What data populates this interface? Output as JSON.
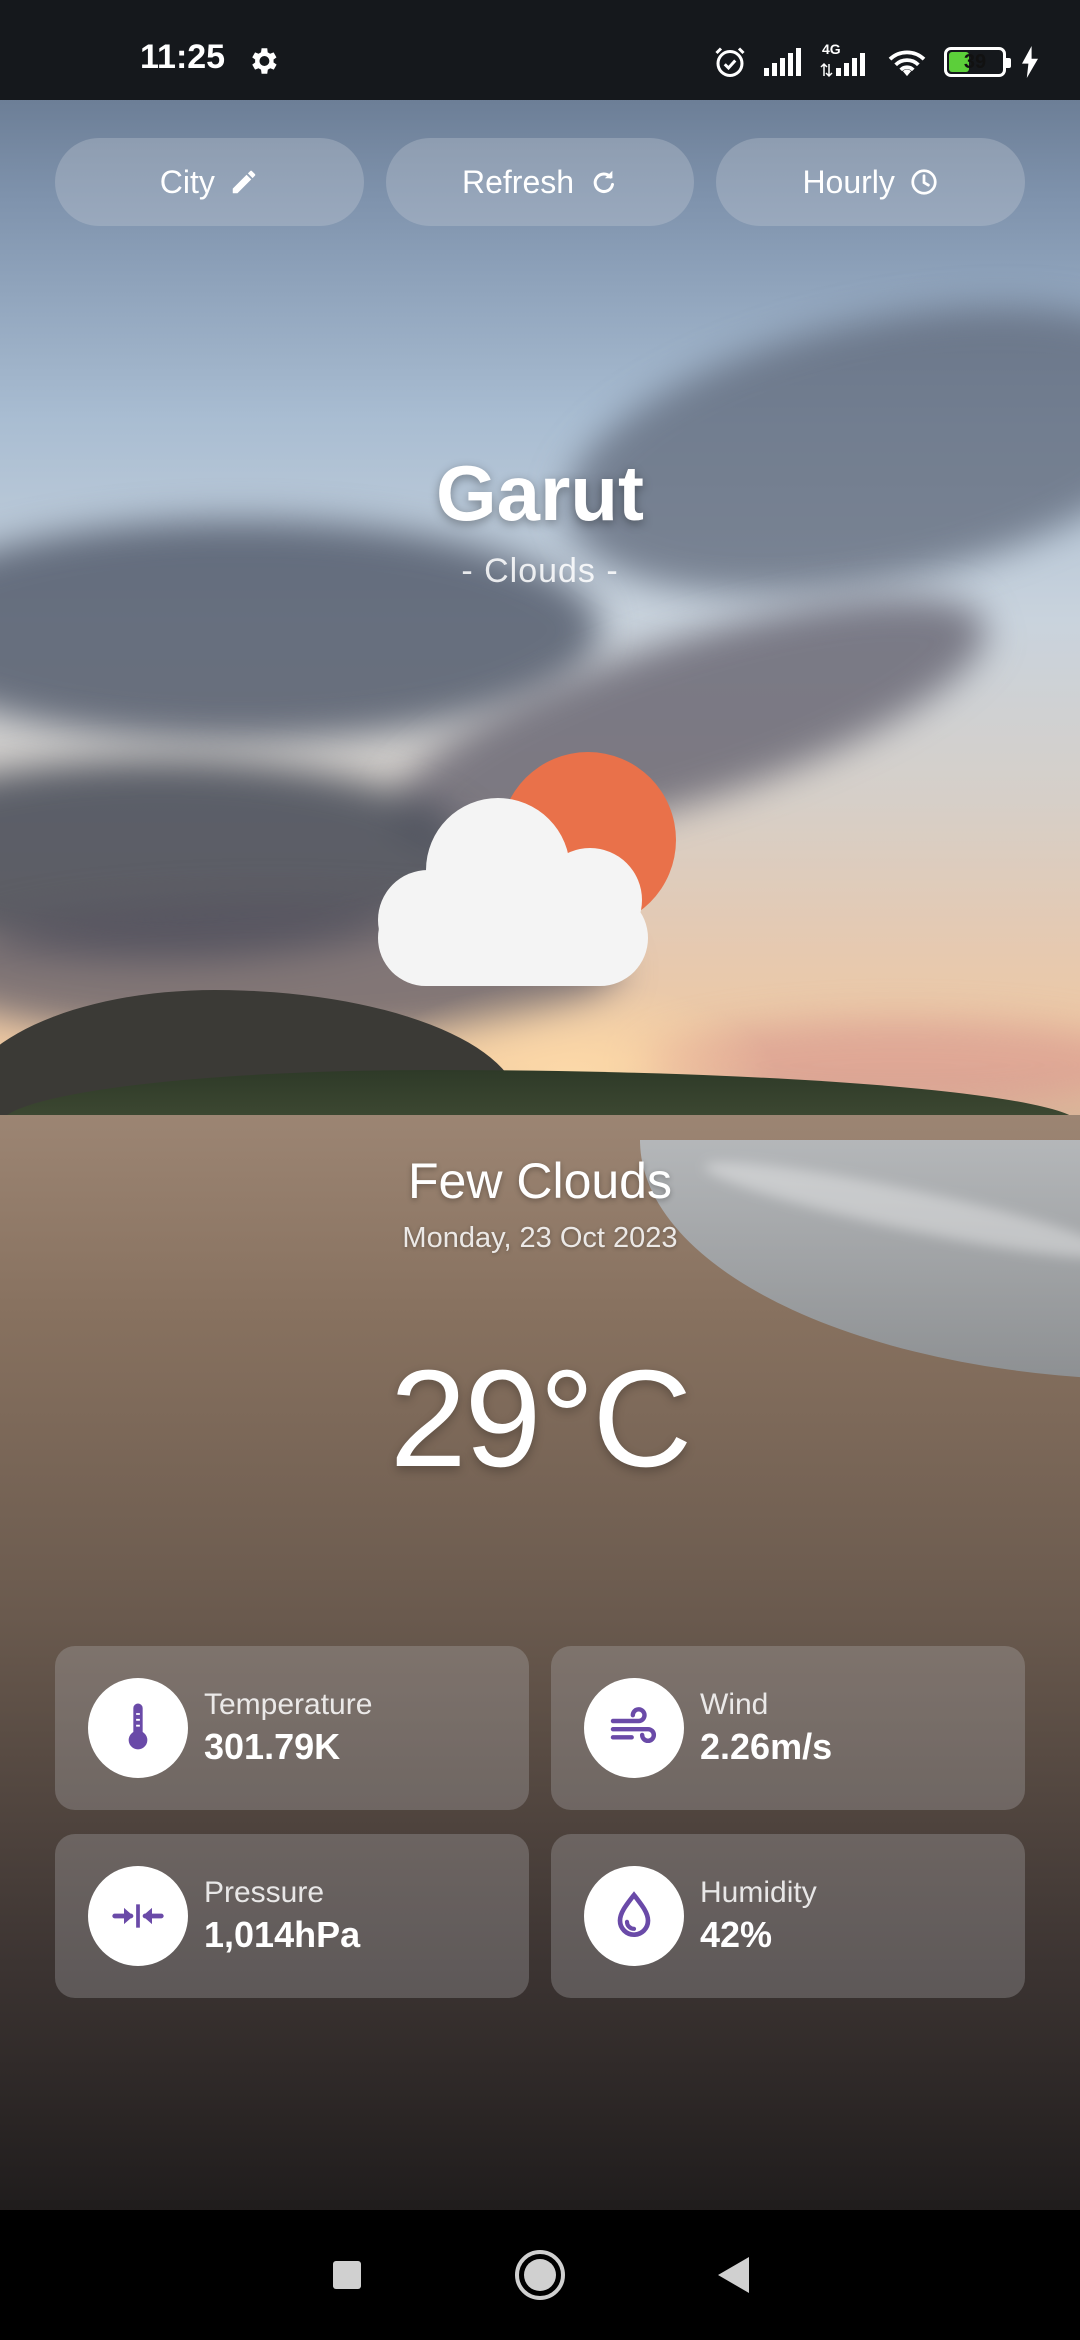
{
  "status_bar": {
    "time": "11:25",
    "network": "4G",
    "battery": "39",
    "battery_level_percent": 39
  },
  "actions": {
    "city_label": "City",
    "refresh_label": "Refresh",
    "hourly_label": "Hourly"
  },
  "weather": {
    "city": "Garut",
    "condition": "- Clouds -",
    "description": "Few Clouds",
    "date": "Monday, 23 Oct 2023",
    "temperature": "29°C"
  },
  "stats": [
    {
      "label": "Temperature",
      "value": "301.79K",
      "icon": "thermometer-icon"
    },
    {
      "label": "Wind",
      "value": "2.26m/s",
      "icon": "wind-icon"
    },
    {
      "label": "Pressure",
      "value": "1,014hPa",
      "icon": "pressure-icon"
    },
    {
      "label": "Humidity",
      "value": "42%",
      "icon": "droplet-icon"
    }
  ],
  "colors": {
    "accent": "#6a4aa8",
    "sun": "#e9714a",
    "battery_fill": "#5ccf3a"
  }
}
